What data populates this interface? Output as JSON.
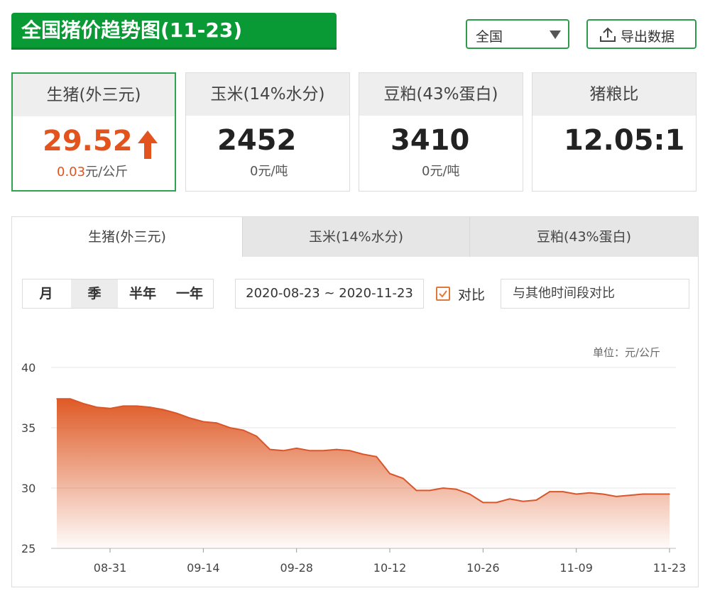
{
  "header": {
    "title": "全国猪价趋势图(11-23)"
  },
  "region": {
    "selected": "全国"
  },
  "export": {
    "label": "导出数据",
    "icon": "export-icon"
  },
  "cards": [
    {
      "title": "生猪(外三元)",
      "value": "29.52",
      "change": "0.03",
      "unit": "元/公斤",
      "trend": "up"
    },
    {
      "title": "玉米(14%水分)",
      "value": "2452",
      "change": "0",
      "unit": "元/吨"
    },
    {
      "title": "豆粕(43%蛋白)",
      "value": "3410",
      "change": "0",
      "unit": "元/吨"
    },
    {
      "title": "猪粮比",
      "value": "12.05:1"
    }
  ],
  "tabs": [
    "生猪(外三元)",
    "玉米(14%水分)",
    "豆粕(43%蛋白)"
  ],
  "active_tab": 0,
  "periods": [
    "月",
    "季",
    "半年",
    "一年"
  ],
  "active_period": 1,
  "date_range": "2020-08-23 ~ 2020-11-23",
  "compare": {
    "checked": true,
    "label": "对比",
    "placeholder": "与其他时间段对比"
  },
  "colors": {
    "brand": "#0a9a35",
    "accent": "#e2531d",
    "line": "#d9562a"
  },
  "chart_data": {
    "type": "area",
    "unit_label": "单位：元/公斤",
    "x_ticks": [
      "08-31",
      "09-14",
      "09-28",
      "10-12",
      "10-26",
      "11-09",
      "11-23"
    ],
    "y_ticks": [
      25,
      30,
      35,
      40
    ],
    "ylim": [
      25,
      40
    ],
    "x": [
      "08-23",
      "08-25",
      "08-27",
      "08-29",
      "08-31",
      "09-02",
      "09-04",
      "09-06",
      "09-08",
      "09-10",
      "09-12",
      "09-14",
      "09-16",
      "09-18",
      "09-20",
      "09-22",
      "09-24",
      "09-26",
      "09-28",
      "09-30",
      "10-02",
      "10-04",
      "10-06",
      "10-08",
      "10-10",
      "10-12",
      "10-14",
      "10-16",
      "10-18",
      "10-20",
      "10-22",
      "10-24",
      "10-26",
      "10-28",
      "10-30",
      "11-01",
      "11-03",
      "11-05",
      "11-07",
      "11-09",
      "11-11",
      "11-13",
      "11-15",
      "11-17",
      "11-19",
      "11-21",
      "11-23"
    ],
    "values": [
      37.4,
      37.4,
      37.0,
      36.7,
      36.6,
      36.8,
      36.8,
      36.7,
      36.5,
      36.2,
      35.8,
      35.5,
      35.4,
      35.0,
      34.8,
      34.3,
      33.2,
      33.1,
      33.3,
      33.1,
      33.1,
      33.2,
      33.1,
      32.8,
      32.6,
      31.2,
      30.8,
      29.8,
      29.8,
      30.0,
      29.9,
      29.5,
      28.8,
      28.8,
      29.1,
      28.9,
      29.0,
      29.7,
      29.7,
      29.5,
      29.6,
      29.5,
      29.3,
      29.4,
      29.5,
      29.5,
      29.5
    ],
    "grid": true
  }
}
